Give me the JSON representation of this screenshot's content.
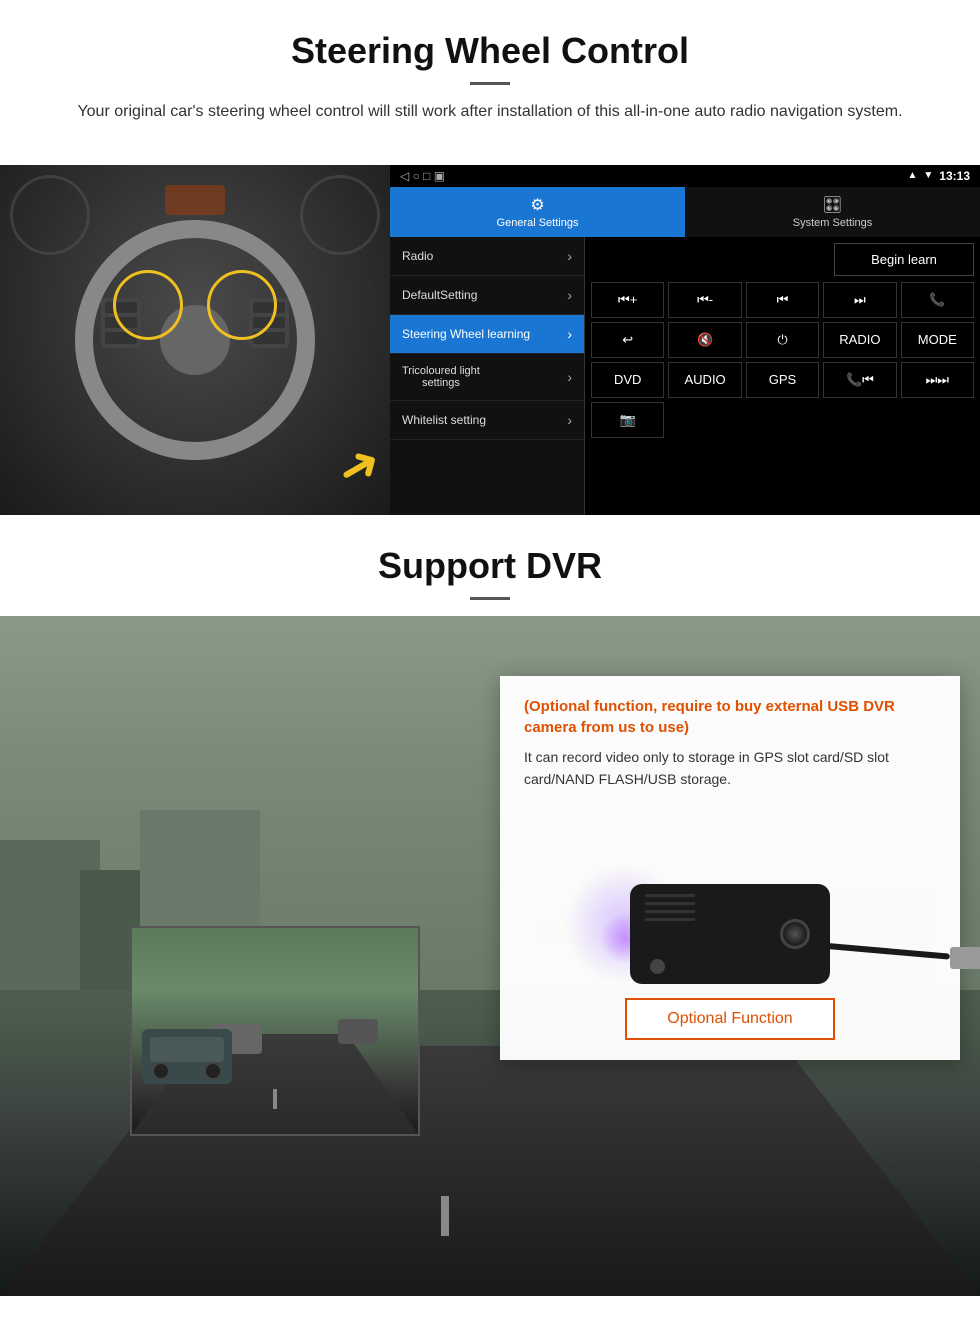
{
  "section1": {
    "title": "Steering Wheel Control",
    "subtitle": "Your original car's steering wheel control will still work after installation of this all-in-one auto radio navigation system.",
    "divider": "—"
  },
  "tablet": {
    "statusbar": {
      "time": "13:13",
      "icons": [
        "signal",
        "wifi",
        "battery"
      ]
    },
    "nav_buttons": [
      "◁",
      "○",
      "□",
      "▣"
    ],
    "tabs": [
      {
        "icon": "⚙",
        "label": "General Settings",
        "active": true
      },
      {
        "icon": "🎮",
        "label": "System Settings",
        "active": false
      }
    ],
    "menu_items": [
      {
        "label": "Radio",
        "active": false
      },
      {
        "label": "DefaultSetting",
        "active": false
      },
      {
        "label": "Steering Wheel learning",
        "active": true
      },
      {
        "label": "Tricoloured light settings",
        "active": false
      },
      {
        "label": "Whitelist setting",
        "active": false
      }
    ],
    "begin_learn_label": "Begin learn",
    "control_buttons_row1": [
      "⏮+",
      "⏮-",
      "⏮",
      "⏭",
      "📞"
    ],
    "control_buttons_row2": [
      "↩",
      "🔇",
      "⏻",
      "RADIO",
      "MODE"
    ],
    "control_buttons_row3": [
      "DVD",
      "AUDIO",
      "GPS",
      "📞⏮",
      "⏭⏭"
    ],
    "control_buttons_row4": [
      "📷"
    ]
  },
  "section2": {
    "title": "Support DVR",
    "divider": "—",
    "optional_text": "(Optional function, require to buy external USB DVR camera from us to use)",
    "desc_text": "It can record video only to storage in GPS slot card/SD slot card/NAND FLASH/USB storage.",
    "optional_function_label": "Optional Function"
  }
}
